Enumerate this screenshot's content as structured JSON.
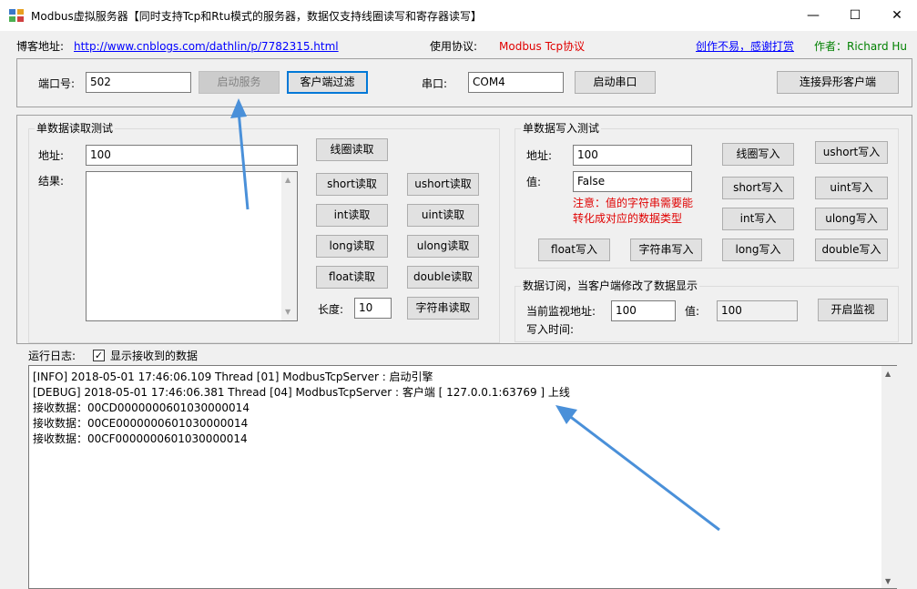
{
  "window": {
    "title": "Modbus虚拟服务器【同时支持Tcp和Rtu模式的服务器，数据仅支持线圈读写和寄存器读写】",
    "minimize": "—",
    "maximize": "☐",
    "close": "✕"
  },
  "info_bar": {
    "blog_label": "博客地址:",
    "blog_url": "http://www.cnblogs.com/dathlin/p/7782315.html",
    "protocol_label": "使用协议:",
    "protocol_value": "Modbus Tcp协议",
    "donate_text": "创作不易，感谢打赏",
    "author": "作者：Richard Hu"
  },
  "connection": {
    "port_label": "端口号:",
    "port_value": "502",
    "start_service": "启动服务",
    "client_filter": "客户端过滤",
    "serial_label": "串口:",
    "serial_value": "COM4",
    "start_serial": "启动串口",
    "connect_special": "连接异形客户端"
  },
  "read_test": {
    "title": "单数据读取测试",
    "address_label": "地址:",
    "address_value": "100",
    "result_label": "结果:",
    "coil_read": "线圈读取",
    "short_read": "short读取",
    "ushort_read": "ushort读取",
    "int_read": "int读取",
    "uint_read": "uint读取",
    "long_read": "long读取",
    "ulong_read": "ulong读取",
    "float_read": "float读取",
    "double_read": "double读取",
    "length_label": "长度:",
    "length_value": "10",
    "string_read": "字符串读取"
  },
  "write_test": {
    "title": "单数据写入测试",
    "address_label": "地址:",
    "address_value": "100",
    "value_label": "值:",
    "value_value": "False",
    "note_line1": "注意：值的字符串需要能",
    "note_line2": "转化成对应的数据类型",
    "coil_write": "线圈写入",
    "ushort_write": "ushort写入",
    "short_write": "short写入",
    "uint_write": "uint写入",
    "int_write": "int写入",
    "ulong_write": "ulong写入",
    "float_write": "float写入",
    "string_write": "字符串写入",
    "long_write": "long写入",
    "double_write": "double写入"
  },
  "subscribe": {
    "title": "数据订阅，当客户端修改了数据显示",
    "monitor_addr_label": "当前监视地址:",
    "monitor_addr_value": "100",
    "value_label": "值:",
    "value_value": "100",
    "start_monitor": "开启监视",
    "write_time_label": "写入时间:"
  },
  "log": {
    "label": "运行日志:",
    "show_received_label": "显示接收到的数据",
    "show_received_checked": "✓",
    "lines": [
      "[INFO] 2018-05-01 17:46:06.109 Thread [01] ModbusTcpServer : 启动引擎",
      "[DEBUG] 2018-05-01 17:46:06.381 Thread [04] ModbusTcpServer : 客户端 [ 127.0.0.1:63769 ] 上线",
      "接收数据：00CD0000000601030000014",
      "接收数据：00CE0000000601030000014",
      "接收数据：00CF0000000601030000014"
    ]
  },
  "colors": {
    "red": "#e00000",
    "green": "#008000",
    "link": "#0000ff",
    "arrow": "#4a90d9",
    "primary_border": "#0078d7"
  },
  "icons": {
    "app": "app-window-icon",
    "check": "checkmark-icon",
    "scroll_up": "scroll-up-arrow-icon",
    "scroll_down": "scroll-down-arrow-icon"
  }
}
